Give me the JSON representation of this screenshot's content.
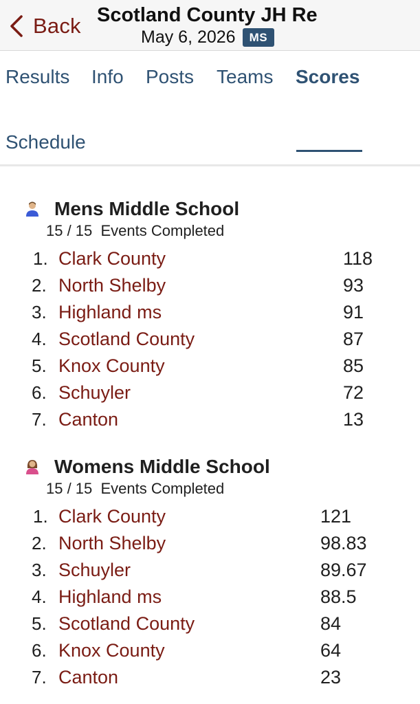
{
  "header": {
    "back_label": "Back",
    "title": "Scotland County JH Re",
    "date": "May 6, 2026",
    "badge": "MS"
  },
  "tabs": [
    {
      "label": "Results",
      "active": false
    },
    {
      "label": "Info",
      "active": false
    },
    {
      "label": "Posts",
      "active": false
    },
    {
      "label": "Teams",
      "active": false
    },
    {
      "label": "Scores",
      "active": true
    },
    {
      "label": "Schedule",
      "active": false
    }
  ],
  "sections": [
    {
      "icon": "man-runner-icon",
      "title": "Mens Middle School",
      "events_completed": "15 / 15  Events Completed",
      "rows": [
        {
          "rank": "1.",
          "team": "Clark County",
          "score": "118"
        },
        {
          "rank": "2.",
          "team": "North Shelby",
          "score": "93"
        },
        {
          "rank": "3.",
          "team": "Highland ms",
          "score": "91"
        },
        {
          "rank": "4.",
          "team": "Scotland County",
          "score": "87"
        },
        {
          "rank": "5.",
          "team": "Knox County",
          "score": "85"
        },
        {
          "rank": "6.",
          "team": "Schuyler",
          "score": "72"
        },
        {
          "rank": "7.",
          "team": "Canton",
          "score": "13"
        }
      ]
    },
    {
      "icon": "woman-runner-icon",
      "title": "Womens Middle School",
      "events_completed": "15 / 15  Events Completed",
      "rows": [
        {
          "rank": "1.",
          "team": "Clark County",
          "score": "121"
        },
        {
          "rank": "2.",
          "team": "North Shelby",
          "score": "98.83"
        },
        {
          "rank": "3.",
          "team": "Schuyler",
          "score": "89.67"
        },
        {
          "rank": "4.",
          "team": "Highland ms",
          "score": "88.5"
        },
        {
          "rank": "5.",
          "team": "Scotland County",
          "score": "84"
        },
        {
          "rank": "6.",
          "team": "Knox County",
          "score": "64"
        },
        {
          "rank": "7.",
          "team": "Canton",
          "score": "23"
        }
      ]
    }
  ],
  "colors": {
    "accent": "#2f5273",
    "team_link": "#7a1c14",
    "header_bg": "#f6f6f6"
  }
}
